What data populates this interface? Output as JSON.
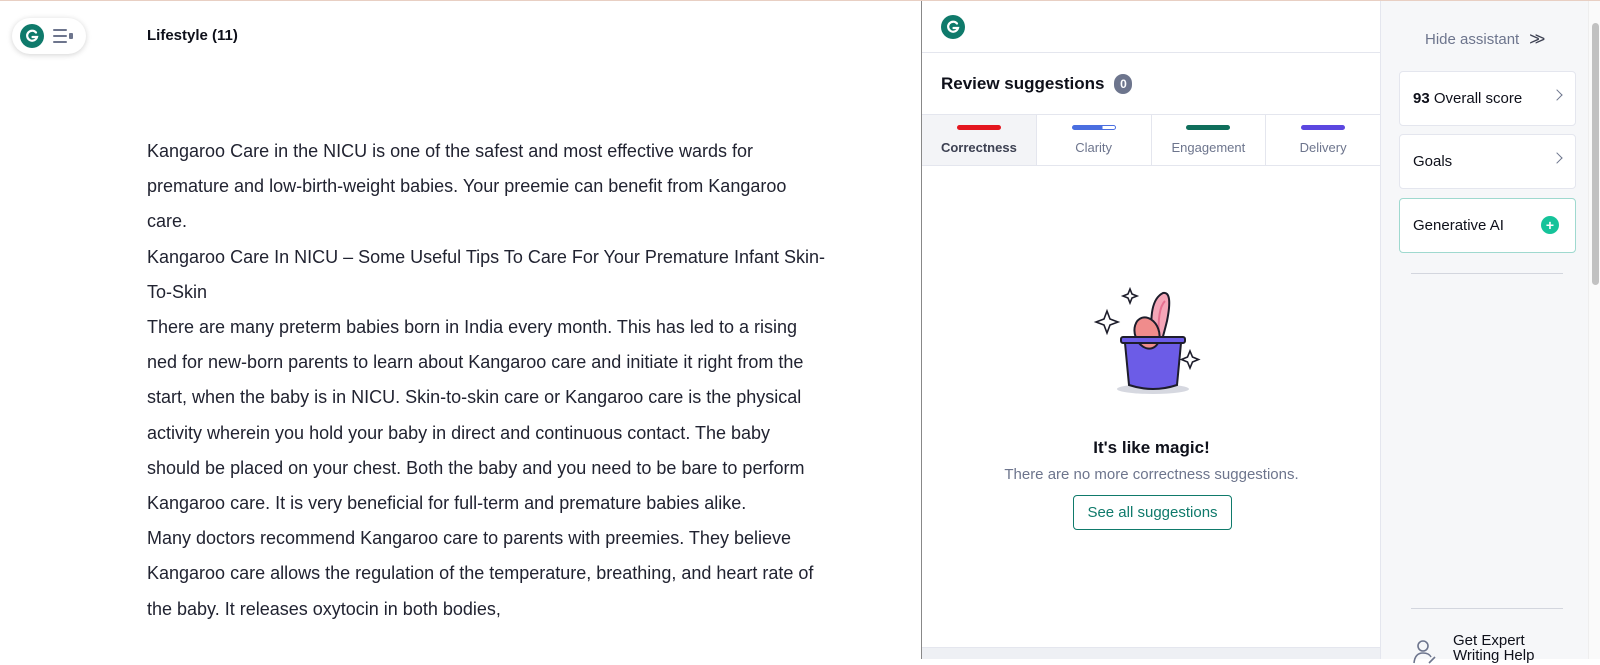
{
  "editor": {
    "doc_title": "Lifestyle (11)",
    "paragraphs": [
      "Kangaroo Care in the NICU is one of the safest and most effective wards for premature and low-birth-weight babies. Your preemie can benefit from Kangaroo care.",
      "Kangaroo Care In NICU – Some Useful Tips To Care For Your Premature Infant Skin-To-Skin",
      "There are many preterm babies born in India every month. This has led to a rising ned for new-born parents to learn about Kangaroo care and initiate it right from the start, when the baby is in NICU. Skin-to-skin care or Kangaroo care is the physical activity wherein you hold your baby in direct and continuous contact. The baby should be placed on your chest. Both the baby and you need to be bare to perform Kangaroo care. It is very beneficial for full-term and premature babies alike.",
      "Many doctors recommend Kangaroo care to parents with preemies. They believe Kangaroo care allows the regulation of the temperature, breathing, and heart rate of the baby. It releases oxytocin in both bodies,"
    ]
  },
  "panel": {
    "review_title": "Review suggestions",
    "suggestion_count": "0",
    "tabs": [
      {
        "label": "Correctness",
        "color": "#e4161f",
        "active": true
      },
      {
        "label": "Clarity",
        "color": "#4a6ee0",
        "active": false
      },
      {
        "label": "Engagement",
        "color": "#0f6e5b",
        "active": false
      },
      {
        "label": "Delivery",
        "color": "#5b47e0",
        "active": false
      }
    ],
    "empty_title": "It's like magic!",
    "empty_subtitle": "There are no more correctness suggestions.",
    "see_all_label": "See all suggestions"
  },
  "rail": {
    "hide_label": "Hide assistant",
    "score_value": "93",
    "score_label": "Overall score",
    "goals_label": "Goals",
    "ai_label": "Generative AI",
    "expert_line1": "Get Expert",
    "expert_line2": "Writing Help"
  },
  "colors": {
    "brand": "#15c39a",
    "brand_dark": "#0f7a6b"
  }
}
